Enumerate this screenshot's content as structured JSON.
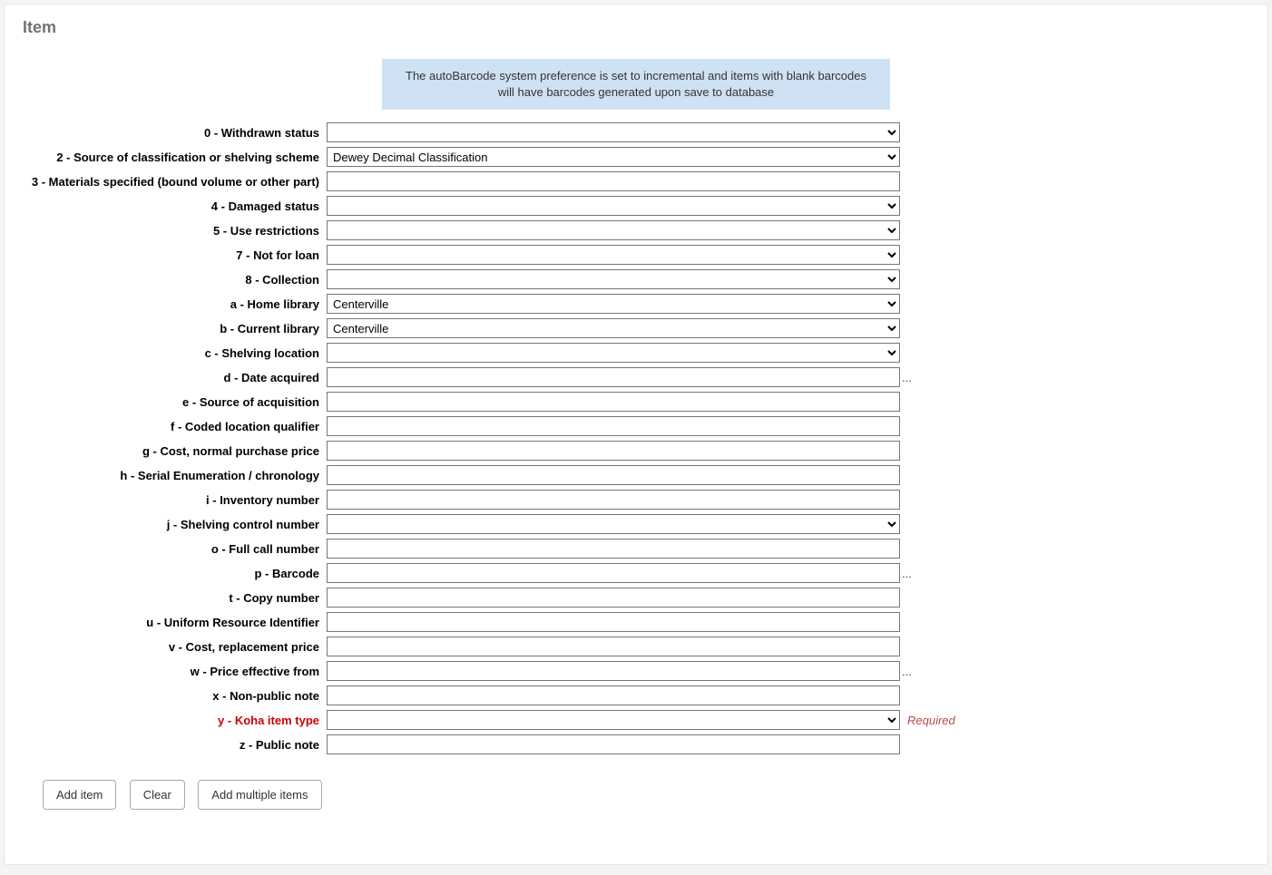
{
  "page_title": "Item",
  "notice": "The autoBarcode system preference is set to incremental and items with blank barcodes will have barcodes generated upon save to database",
  "fields": {
    "withdrawn": {
      "label": "0 - Withdrawn status",
      "value": ""
    },
    "classification": {
      "label": "2 - Source of classification or shelving scheme",
      "value": "Dewey Decimal Classification"
    },
    "materials": {
      "label": "3 - Materials specified (bound volume or other part)",
      "value": ""
    },
    "damaged": {
      "label": "4 - Damaged status",
      "value": ""
    },
    "restrictions": {
      "label": "5 - Use restrictions",
      "value": ""
    },
    "notforloan": {
      "label": "7 - Not for loan",
      "value": ""
    },
    "collection": {
      "label": "8 - Collection",
      "value": ""
    },
    "home_library": {
      "label": "a - Home library",
      "value": "Centerville"
    },
    "current_library": {
      "label": "b - Current library",
      "value": "Centerville"
    },
    "location": {
      "label": "c - Shelving location",
      "value": ""
    },
    "date_acquired": {
      "label": "d - Date acquired",
      "value": ""
    },
    "source_acq": {
      "label": "e - Source of acquisition",
      "value": ""
    },
    "coded_loc": {
      "label": "f - Coded location qualifier",
      "value": ""
    },
    "cost_normal": {
      "label": "g - Cost, normal purchase price",
      "value": ""
    },
    "serial_enum": {
      "label": "h - Serial Enumeration / chronology",
      "value": ""
    },
    "inventory": {
      "label": "i - Inventory number",
      "value": ""
    },
    "shelving_ctrl": {
      "label": "j - Shelving control number",
      "value": ""
    },
    "full_call": {
      "label": "o - Full call number",
      "value": ""
    },
    "barcode": {
      "label": "p - Barcode",
      "value": ""
    },
    "copy_number": {
      "label": "t - Copy number",
      "value": ""
    },
    "uri": {
      "label": "u - Uniform Resource Identifier",
      "value": ""
    },
    "cost_replace": {
      "label": "v - Cost, replacement price",
      "value": ""
    },
    "price_effective": {
      "label": "w - Price effective from",
      "value": ""
    },
    "nonpublic_note": {
      "label": "x - Non-public note",
      "value": ""
    },
    "item_type": {
      "label": "y - Koha item type",
      "value": ""
    },
    "public_note": {
      "label": "z - Public note",
      "value": ""
    }
  },
  "ellipsis": "...",
  "required_tag": "Required",
  "buttons": {
    "add_item": "Add item",
    "clear": "Clear",
    "add_multiple": "Add multiple items"
  }
}
